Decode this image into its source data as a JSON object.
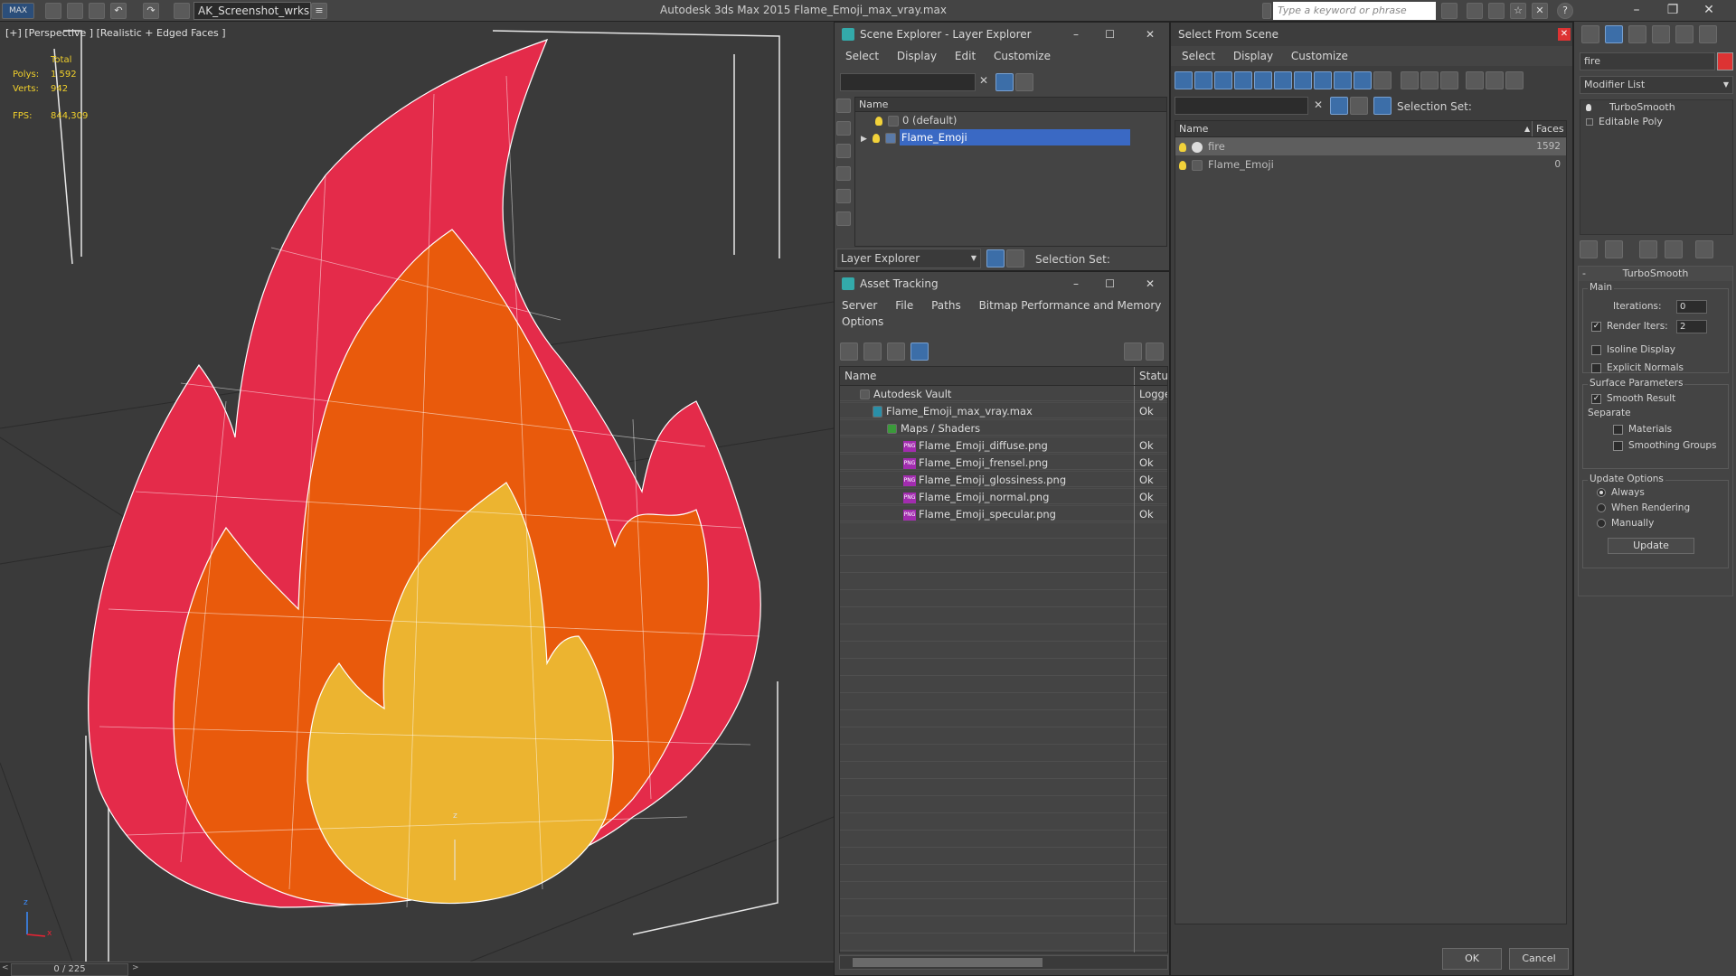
{
  "titlebar": {
    "logo": "MAX",
    "workspace": "AK_Screenshot_wrksp",
    "app_title": "Autodesk 3ds Max  2015     Flame_Emoji_max_vray.max",
    "search_placeholder": "Type a keyword or phrase"
  },
  "viewport": {
    "label": "[+] [Perspective ] [Realistic + Edged Faces ]",
    "stats": {
      "total_label": "Total",
      "polys_label": "Polys:",
      "polys_value": "1 592",
      "verts_label": "Verts:",
      "verts_value": "942",
      "fps_label": "FPS:",
      "fps_value": "844,309"
    },
    "axis_x": "x",
    "axis_y": "y",
    "axis_z": "z"
  },
  "timeline": {
    "frame": "0 / 225"
  },
  "scene_explorer": {
    "title": "Scene Explorer - Layer Explorer",
    "menu": [
      "Select",
      "Display",
      "Edit",
      "Customize"
    ],
    "col_name": "Name",
    "rows": [
      "0 (default)",
      "Flame_Emoji"
    ],
    "footer_dropdown": "Layer Explorer",
    "selection_set": "Selection Set:"
  },
  "asset_tracking": {
    "title": "Asset Tracking",
    "menu1": [
      "Server",
      "File",
      "Paths",
      "Bitmap Performance and Memory"
    ],
    "menu2": [
      "Options"
    ],
    "col_name": "Name",
    "col_status": "Status",
    "rows": [
      {
        "name": "Autodesk Vault",
        "status": "Logged"
      },
      {
        "name": "Flame_Emoji_max_vray.max",
        "status": "Ok"
      },
      {
        "name": "Maps / Shaders",
        "status": ""
      },
      {
        "name": "Flame_Emoji_diffuse.png",
        "status": "Ok"
      },
      {
        "name": "Flame_Emoji_frensel.png",
        "status": "Ok"
      },
      {
        "name": "Flame_Emoji_glossiness.png",
        "status": "Ok"
      },
      {
        "name": "Flame_Emoji_normal.png",
        "status": "Ok"
      },
      {
        "name": "Flame_Emoji_specular.png",
        "status": "Ok"
      }
    ],
    "png_tag": "PNG"
  },
  "select_from_scene": {
    "title": "Select From Scene",
    "menu": [
      "Select",
      "Display",
      "Customize"
    ],
    "selection_set": "Selection Set:",
    "col_name": "Name",
    "col_faces": "Faces",
    "rows": [
      {
        "name": "fire",
        "faces": "1592"
      },
      {
        "name": "Flame_Emoji",
        "faces": "0"
      }
    ],
    "ok": "OK",
    "cancel": "Cancel"
  },
  "command_panel": {
    "name_field": "fire",
    "modifier_list": "Modifier List",
    "stack": [
      "TurboSmooth",
      "Editable Poly"
    ],
    "rollout_title": "TurboSmooth",
    "main_group": "Main",
    "iterations_label": "Iterations:",
    "iterations_value": "0",
    "render_iters_label": "Render Iters:",
    "render_iters_value": "2",
    "isoline": "Isoline Display",
    "explicit_normals": "Explicit Normals",
    "surface_group": "Surface Parameters",
    "smooth_result": "Smooth Result",
    "separate": "Separate",
    "materials": "Materials",
    "smoothing_groups": "Smoothing Groups",
    "update_group": "Update Options",
    "always": "Always",
    "when_rendering": "When Rendering",
    "manually": "Manually",
    "update_btn": "Update"
  },
  "colors": {
    "selection": "#3a69c4",
    "flame_outer": "#e42b4a",
    "flame_mid": "#e95a0c",
    "flame_inner": "#ecb430",
    "stats": "#f1d02b"
  }
}
